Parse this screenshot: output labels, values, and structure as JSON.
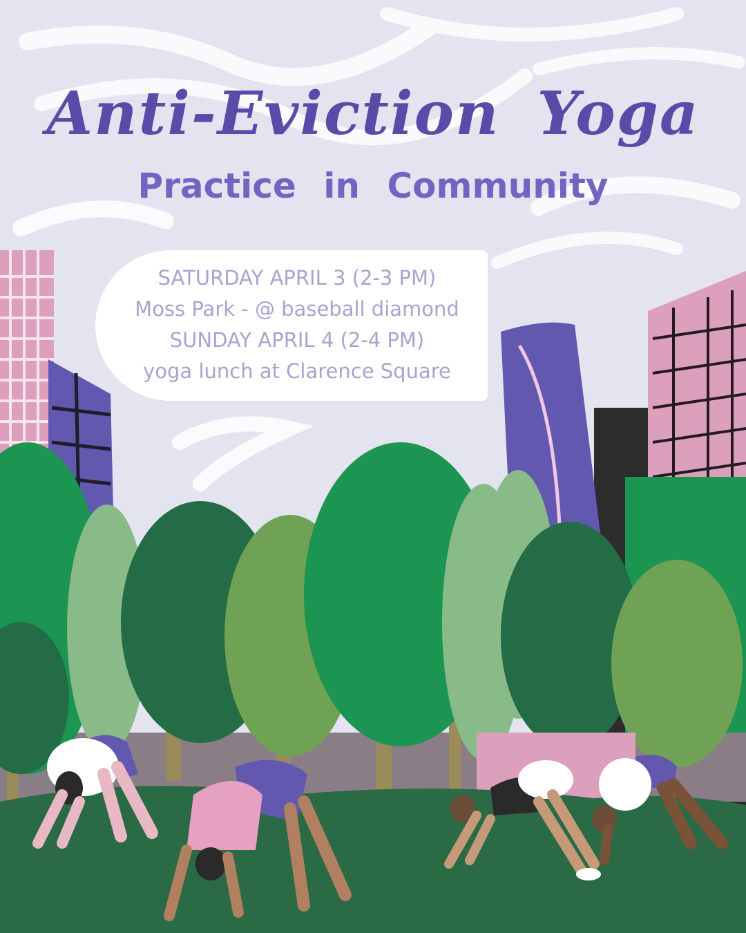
{
  "poster": {
    "title": "Anti-Eviction Yoga",
    "subtitle": "Practice in Community",
    "events": [
      "SATURDAY APRIL 3 (2-3 PM)",
      "Moss Park - @ baseball diamond",
      "SUNDAY APRIL 4 (2-4 PM)",
      "yoga lunch at Clarence Square"
    ]
  },
  "colors": {
    "sky": "#e4e3f0",
    "title": "#5c4aa8",
    "subtitle": "#7563c2",
    "event_text": "#a9a3cf",
    "building_pink": "#dca0bc",
    "building_purple": "#6258b0",
    "tree_dark": "#236c45",
    "tree_mid": "#1c9452",
    "tree_light": "#88bb88",
    "grass": "#2a6a44"
  }
}
